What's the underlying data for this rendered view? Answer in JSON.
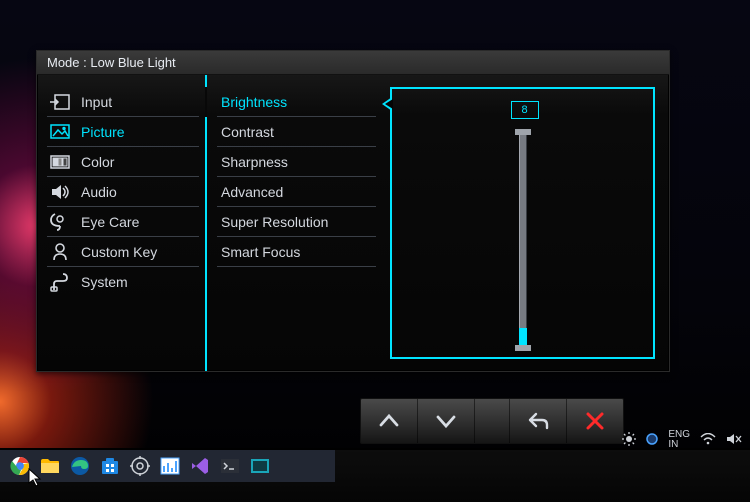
{
  "mode_prefix": "Mode :",
  "mode_name": "Low Blue Light",
  "categories": [
    {
      "id": "input",
      "label": "Input"
    },
    {
      "id": "picture",
      "label": "Picture"
    },
    {
      "id": "color",
      "label": "Color"
    },
    {
      "id": "audio",
      "label": "Audio"
    },
    {
      "id": "eyecare",
      "label": "Eye Care"
    },
    {
      "id": "customkey",
      "label": "Custom Key"
    },
    {
      "id": "system",
      "label": "System"
    }
  ],
  "active_category": "picture",
  "sub_items": [
    {
      "id": "brightness",
      "label": "Brightness"
    },
    {
      "id": "contrast",
      "label": "Contrast"
    },
    {
      "id": "sharpness",
      "label": "Sharpness"
    },
    {
      "id": "advanced",
      "label": "Advanced"
    },
    {
      "id": "superresolution",
      "label": "Super Resolution"
    },
    {
      "id": "smartfocus",
      "label": "Smart Focus"
    }
  ],
  "active_sub": "brightness",
  "brightness_value": 8,
  "brightness_max": 100,
  "language": {
    "top": "ENG",
    "bottom": "IN"
  },
  "colors": {
    "accent": "#00e4ff",
    "text": "#d4d8df",
    "close": "#ff2a2a"
  }
}
